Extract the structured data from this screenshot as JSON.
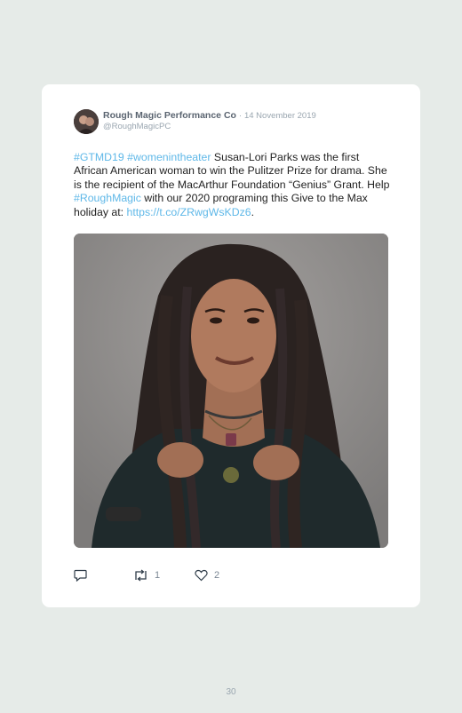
{
  "tweet": {
    "author_name": "Rough Magic Performance Co",
    "separator": "·",
    "date": "14 November 2019",
    "handle": "@RoughMagicPC",
    "segments": [
      {
        "text": "#GTMD19",
        "link": true
      },
      {
        "text": " ",
        "link": false
      },
      {
        "text": "#womenintheater",
        "link": true
      },
      {
        "text": " Susan-Lori Parks was the first African American woman to win the Pulitzer Prize for drama. She is the recipient of the MacArthur Foundation “Genius” Grant. Help ",
        "link": false
      },
      {
        "text": "#RoughMagic",
        "link": true
      },
      {
        "text": " with our 2020 programing this Give to the Max holiday at: ",
        "link": false
      },
      {
        "text": "https://t.co/ZRwgWsKDz6",
        "link": true
      },
      {
        "text": ".",
        "link": false
      }
    ],
    "reply_icon": "reply-icon",
    "retweet_icon": "retweet-icon",
    "like_icon": "heart-icon",
    "retweet_count": "1",
    "like_count": "2"
  },
  "colors": {
    "page_background": "#e6ebe8",
    "card_background": "#ffffff",
    "link": "#5fb8e8",
    "muted": "#9aa6b0"
  },
  "page_number": "30"
}
